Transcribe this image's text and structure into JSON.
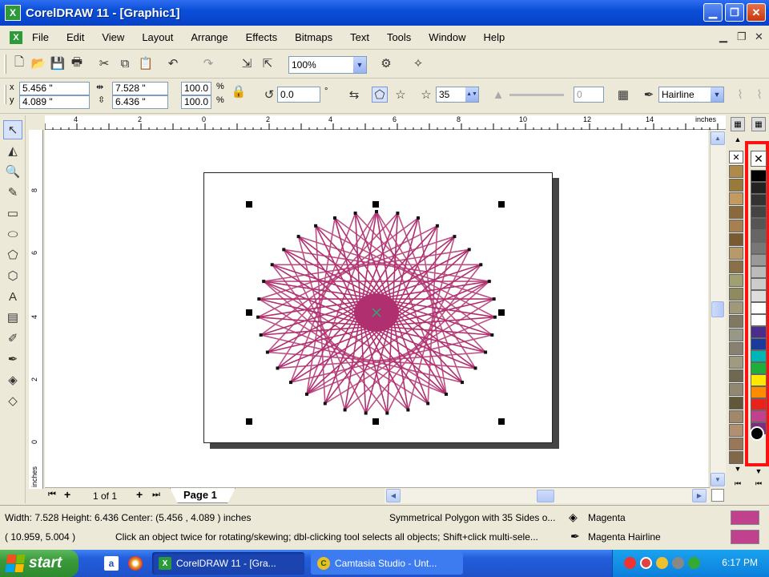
{
  "window": {
    "title": "CorelDRAW 11 - [Graphic1]"
  },
  "menu": [
    "File",
    "Edit",
    "View",
    "Layout",
    "Arrange",
    "Effects",
    "Bitmaps",
    "Text",
    "Tools",
    "Window",
    "Help"
  ],
  "standard_toolbar": {
    "zoom": "100%"
  },
  "property_bar": {
    "x": "5.456 \"",
    "y": "4.089 \"",
    "width": "7.528 \"",
    "height": "6.436 \"",
    "scale_x": "100.0",
    "scale_y": "100.0",
    "percent": "%",
    "rotation": "0.0",
    "degree": "°",
    "sides": "35",
    "sharpness": "0",
    "outline": "Hairline"
  },
  "ruler": {
    "unit": "inches",
    "h_ticks": [
      "4",
      "2",
      "0",
      "2",
      "4",
      "6",
      "8",
      "10",
      "12",
      "14"
    ],
    "v_ticks": [
      "8",
      "6",
      "4",
      "2",
      "0"
    ],
    "v_unit": "inches"
  },
  "page_nav": {
    "page_count": "1 of 1",
    "page_tab": "Page 1"
  },
  "status": {
    "dimensions": "Width: 7.528  Height: 6.436  Center: (5.456 , 4.089 )  inches",
    "object": "Symmetrical Polygon with 35 Sides o...",
    "fill": "Magenta",
    "cursor": "( 10.959, 5.004 )",
    "hint": "Click an object twice for rotating/skewing; dbl-clicking tool selects all objects; Shift+click multi-sele...",
    "outline": "Magenta  Hairline",
    "fill_color": "#c0418e"
  },
  "shape": {
    "color": "#b0306f",
    "sides": 35
  },
  "taskbar": {
    "start": "start",
    "tasks": [
      "CorelDRAW 11 - [Gra...",
      "Camtasia Studio - Unt..."
    ],
    "clock": "6:17 PM"
  },
  "palette_colors": [
    "#000000",
    "#222222",
    "#333333",
    "#444444",
    "#555555",
    "#666666",
    "#777777",
    "#999999",
    "#bbbbbb",
    "#cccccc",
    "#dddddd",
    "#ffffff",
    "#ffffff",
    "#4b2d8c",
    "#1a3b9c",
    "#00b5b5",
    "#1fae3a",
    "#ffe800",
    "#ff8c00",
    "#e8231c",
    "#c0418e",
    "#7d2d7d"
  ],
  "palette1_colors": [
    "#b08a4a",
    "#9a7a3a",
    "#c49a60",
    "#8a6a3a",
    "#a88050",
    "#7a5a30",
    "#b89a6a",
    "#8a7048",
    "#a0a070",
    "#908a60",
    "#a09878",
    "#807860",
    "#989888",
    "#888070",
    "#a09a80",
    "#706850",
    "#908870",
    "#605838",
    "#a08868",
    "#b09070",
    "#987858",
    "#806848"
  ]
}
